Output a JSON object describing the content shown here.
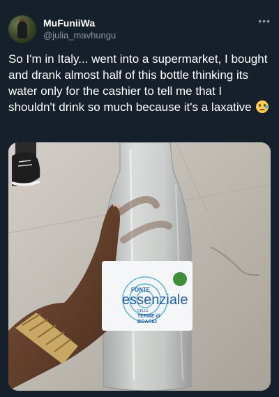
{
  "user": {
    "display_name": "MuFuniiWa",
    "handle": "@julia_mavhungu"
  },
  "more_icon": "ellipsis-icon",
  "tweet_text": "So I'm in Italy... went into a supermarket, I bought and drank almost half of this bottle thinking its water only for the cashier to tell me that I shouldn't drink so much because it's a laxative",
  "emoji": "crying-face-icon",
  "photo": {
    "label_brand_top": "FONTE",
    "label_brand": "essenziale",
    "label_sub_1": "DELLE",
    "label_sub_2": "TERME di",
    "label_sub_3": "BOARIO"
  },
  "colors": {
    "background": "#15202b",
    "text": "#ffffff",
    "secondary_text": "#8b98a5",
    "label_blue": "#1f5fae"
  }
}
